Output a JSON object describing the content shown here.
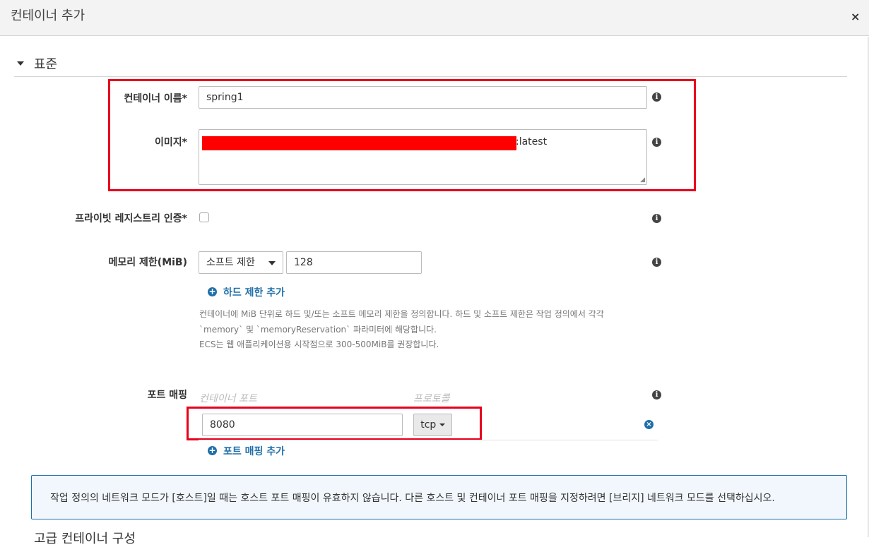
{
  "dialog": {
    "title": "컨테이너 추가",
    "close_icon": "×"
  },
  "section": {
    "title": "표준"
  },
  "container_name": {
    "label": "컨테이너 이름*",
    "value": "spring1"
  },
  "image": {
    "label": "이미지*",
    "value_suffix": ":latest"
  },
  "private_registry": {
    "label": "프라이빗 레지스트리 인증*"
  },
  "memory": {
    "label": "메모리 제한(MiB)",
    "limit_type": "소프트 제한",
    "value": "128",
    "add_hard_limit": "하드 제한 추가",
    "help_line1": "컨테이너에 MiB 단위로 하드 및/또는 소프트 메모리 제한을 정의합니다. 하드 및 소프트 제한은 작업 정의에서 각각",
    "help_line2": "`memory` 및 `memoryReservation` 파라미터에 해당합니다.",
    "help_line3": "ECS는 웹 애플리케이션용 시작점으로 300-500MiB를 권장합니다."
  },
  "port_mapping": {
    "label": "포트 매핑",
    "col_container_port": "컨테이너 포트",
    "col_protocol": "프로토콜",
    "port_value": "8080",
    "protocol_value": "tcp",
    "add_label": "포트 매핑 추가"
  },
  "alert": {
    "text": "작업 정의의 네트워크 모드가 [호스트]일 때는 호스트 포트 매핑이 유효하지 않습니다. 다른 호스트 및 컨테이너 포트 매핑을 지정하려면 [브리지] 네트워크 모드를 선택하십시오."
  },
  "next_section": {
    "title": "고급 컨테이너 구성"
  },
  "icons": {
    "info": "i",
    "plus": "+",
    "remove": "×"
  },
  "colors": {
    "accent": "#1f6fa8",
    "highlight": "#e8001c",
    "redaction": "#ff0000"
  }
}
